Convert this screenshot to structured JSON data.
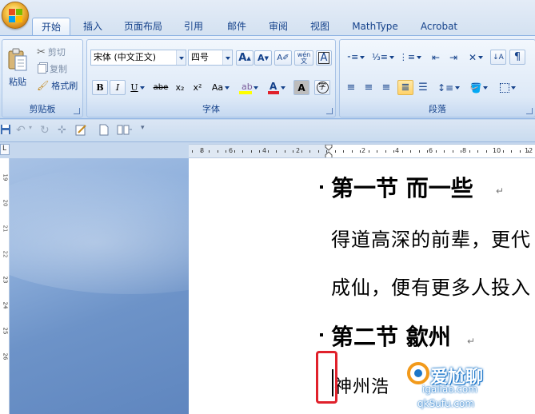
{
  "tabs": [
    "开始",
    "插入",
    "页面布局",
    "引用",
    "邮件",
    "审阅",
    "视图",
    "MathType",
    "Acrobat"
  ],
  "clipboard": {
    "paste_label": "粘贴",
    "cut_label": "剪切",
    "copy_label": "复制",
    "format_painter_label": "格式刷",
    "group_label": "剪贴板"
  },
  "font": {
    "font_name": "宋体 (中文正文)",
    "font_size": "四号",
    "group_label": "字体",
    "bold": "B",
    "italic": "I",
    "underline": "U",
    "strikethrough": "abe",
    "subscript": "x₂",
    "superscript": "x²",
    "change_case": "Aa",
    "grow_font": "A",
    "shrink_font": "A",
    "phonetic": "wén",
    "char_border": "A",
    "char_shading": "A",
    "enclose": "字"
  },
  "paragraph": {
    "group_label": "段落"
  },
  "ruler": {
    "left_numbers": [
      "8",
      "6",
      "4",
      "2"
    ],
    "right_numbers": [
      "2",
      "4",
      "6",
      "8",
      "10",
      "12"
    ],
    "vertical_numbers": [
      "19",
      "20",
      "21",
      "22",
      "23",
      "24",
      "25",
      "26"
    ]
  },
  "document": {
    "heading1": "第一节 而一些",
    "para1": "得道高深的前辈，更代",
    "para2": "成仙，便有更多人投入",
    "heading2": "第二节 歙州",
    "para3": "神州浩"
  },
  "watermark": {
    "brand": "爱尬聊",
    "url1": "igaliao.com",
    "url2": "qkSufu.com"
  },
  "colors": {
    "highlight_box": "#e0212b",
    "highlight_yellow": "#ffff00",
    "font_color_red": "#e0212b"
  }
}
